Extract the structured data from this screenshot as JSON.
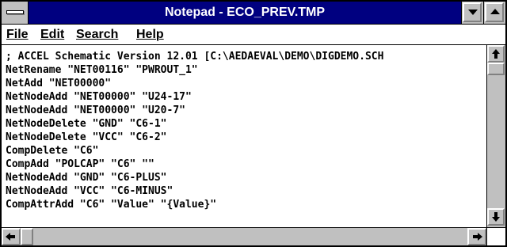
{
  "window": {
    "title": "Notepad - ECO_PREV.TMP",
    "system_menu_icon": "system-menu-bar-icon",
    "minimize_icon": "minimize-triangle-icon",
    "maximize_icon": "maximize-triangle-icon"
  },
  "menubar": {
    "items": [
      {
        "label": "File"
      },
      {
        "label": "Edit"
      },
      {
        "label": "Search"
      },
      {
        "label": "Help"
      }
    ]
  },
  "document": {
    "lines": [
      "; ACCEL Schematic Version 12.01 [C:\\AEDAEVAL\\DEMO\\DIGDEMO.SCH",
      "NetRename \"NET00116\" \"PWROUT_1\"",
      "NetAdd \"NET00000\"",
      "NetNodeAdd \"NET00000\" \"U24-17\"",
      "NetNodeAdd \"NET00000\" \"U20-7\"",
      "NetNodeDelete \"GND\" \"C6-1\"",
      "NetNodeDelete \"VCC\" \"C6-2\"",
      "CompDelete \"C6\"",
      "CompAdd \"POLCAP\" \"C6\" \"\"",
      "NetNodeAdd \"GND\" \"C6-PLUS\"",
      "NetNodeAdd \"VCC\" \"C6-MINUS\"",
      "CompAttrAdd \"C6\" \"Value\" \"{Value}\""
    ]
  },
  "colors": {
    "titlebar": "#000080",
    "chrome": "#c0c0c0",
    "text": "#000000"
  }
}
